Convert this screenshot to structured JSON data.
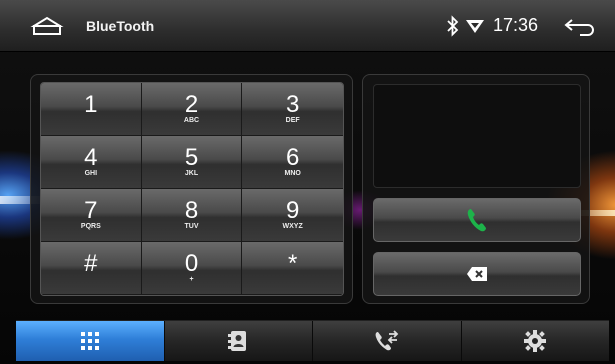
{
  "statusbar": {
    "title": "BlueTooth",
    "time": "17:36",
    "icons": [
      "home-icon",
      "bluetooth-icon",
      "wifi-icon",
      "back-icon"
    ]
  },
  "keypad": {
    "keys": [
      {
        "digit": "1",
        "letters": ""
      },
      {
        "digit": "2",
        "letters": "ABC"
      },
      {
        "digit": "3",
        "letters": "DEF"
      },
      {
        "digit": "4",
        "letters": "GHI"
      },
      {
        "digit": "5",
        "letters": "JKL"
      },
      {
        "digit": "6",
        "letters": "MNO"
      },
      {
        "digit": "7",
        "letters": "PQRS"
      },
      {
        "digit": "8",
        "letters": "TUV"
      },
      {
        "digit": "9",
        "letters": "WXYZ"
      },
      {
        "digit": "#",
        "letters": ""
      },
      {
        "digit": "0",
        "letters": "+"
      },
      {
        "digit": "*",
        "letters": ""
      }
    ]
  },
  "display": {
    "number": ""
  },
  "actions": {
    "call_icon": "phone-call-icon",
    "delete_icon": "backspace-icon",
    "call_color": "#1db34a"
  },
  "tabs": [
    {
      "icon": "dialpad-icon",
      "active": true
    },
    {
      "icon": "contacts-icon",
      "active": false
    },
    {
      "icon": "call-log-icon",
      "active": false
    },
    {
      "icon": "settings-icon",
      "active": false
    }
  ],
  "colors": {
    "active_tab": "#2f7fd8"
  }
}
